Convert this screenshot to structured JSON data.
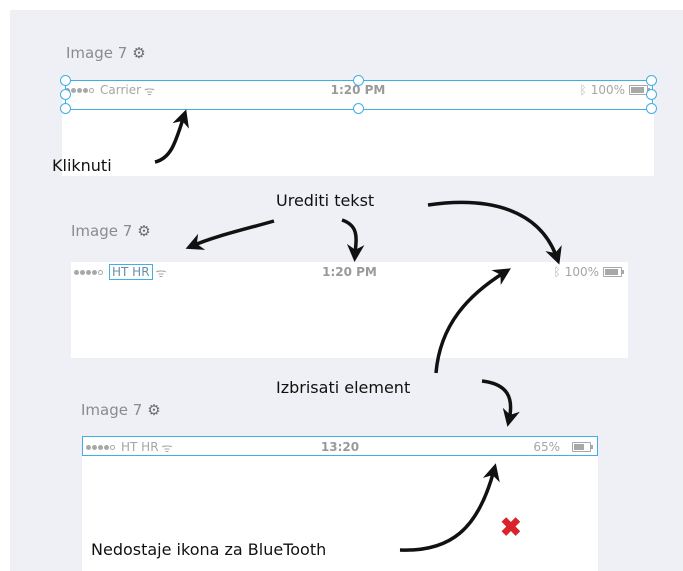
{
  "frames": [
    {
      "label": "Image 7",
      "carrier": "Carrier",
      "time": "1:20 PM",
      "battery": "100%",
      "battery_level": 0.85
    },
    {
      "label": "Image 7",
      "carrier": "HT HR",
      "time": "1:20 PM",
      "battery": "100%",
      "battery_level": 0.85
    },
    {
      "label": "Image 7",
      "carrier": "HT HR",
      "time": "13:20",
      "battery": "65%",
      "battery_level": 0.65
    }
  ],
  "annotations": {
    "click": "Kliknuti",
    "edit_text": "Urediti tekst",
    "delete_element": "Izbrisati element",
    "missing_bluetooth": "Nedostaje ikona za BlueTooth"
  },
  "colors": {
    "selection": "#41aee6",
    "error_mark": "#d9222a"
  },
  "icons": [
    "gear-icon",
    "wifi-icon",
    "bluetooth-icon",
    "battery-icon",
    "signal-dots-icon",
    "x-mark-icon"
  ]
}
